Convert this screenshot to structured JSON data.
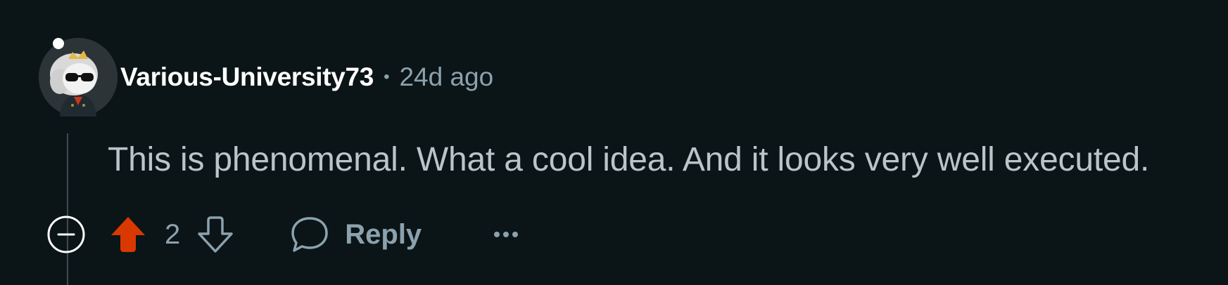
{
  "comment": {
    "author": "Various-University73",
    "separator": "•",
    "timestamp": "24d ago",
    "text": "This is phenomenal. What a cool idea. And it looks very well executed.",
    "score": "2",
    "reply_label": "Reply"
  },
  "icons": {
    "avatar": "avatar",
    "collapse": "collapse-icon",
    "upvote": "upvote-icon",
    "downvote": "downvote-icon",
    "reply": "reply-icon",
    "more": "more-options-icon"
  },
  "colors": {
    "background": "#0b1416",
    "author": "#ffffff",
    "meta": "#8ba2ad",
    "body": "#b8c5c9",
    "upvote_active": "#d93900",
    "thread_line": "#3e4a4f"
  },
  "state": {
    "upvoted": true
  }
}
